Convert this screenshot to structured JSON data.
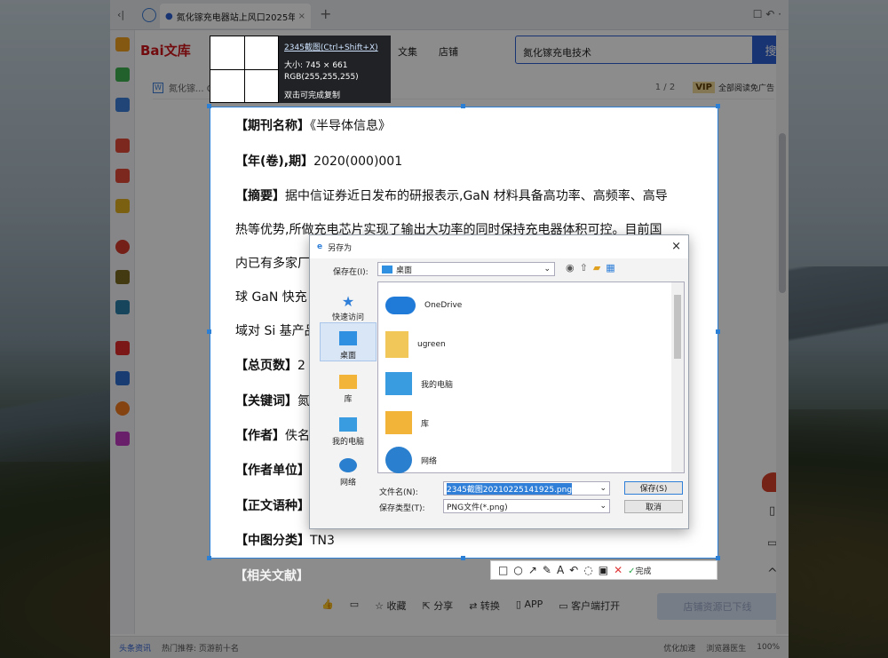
{
  "browser": {
    "tab_title": "氮化镓充电器站上风口2025年",
    "new_tab": "+",
    "site_logo": "Bai文库",
    "nav_items": [
      "文集",
      "店铺"
    ],
    "search_value": "氮化镓充电技术",
    "search_button": "搜",
    "doc_title": "氮化镓... GaN快充市场规模有望达...",
    "page_indicator": "1 / 2",
    "vip_badge": "VIP",
    "vip_text": "全部阅读免广告"
  },
  "magnifier": {
    "hotkey": "2345截图(Ctrl+Shift+X)",
    "size": "大小:  745 × 661",
    "rgb": "RGB(255,255,255)",
    "hint": "双击可完成复制"
  },
  "document": {
    "journal_label": "【期刊名称】",
    "journal": "《半导体信息》",
    "year_label": "【年(卷),期】",
    "year": "2020(000)001",
    "abstract_label": "【摘要】",
    "abstract_1": "据中信证券近日发布的研报表示,GaN 材料具备高功率、高频率、高导",
    "abstract_2": "热等优势,所做充电芯片实现了输出大功率的同时保持充电器体积可控。目前国",
    "abstract_3": "内已有多家厂",
    "abstract_4": "球 GaN 快充",
    "abstract_5": "域对 Si 基产品",
    "pages_label": "【总页数】",
    "pages": "2",
    "keywords_label": "【关键词】",
    "keywords": "氮",
    "author_label": "【作者】",
    "author": "佚名",
    "unit_label": "【作者单位】",
    "lang_label": "【正文语种】",
    "class_label": "【中图分类】",
    "class": "TN3",
    "related_label": "【相关文献】"
  },
  "dialog": {
    "title": "另存为",
    "save_in_label": "保存在(I):",
    "save_in_value": "桌面",
    "nav": [
      "快速访问",
      "桌面",
      "库",
      "我的电脑",
      "网络"
    ],
    "files": [
      "OneDrive",
      "ugreen",
      "我的电脑",
      "库",
      "网络"
    ],
    "filename_label": "文件名(N):",
    "filename_value": "2345截图20210225141925.png",
    "filetype_label": "保存类型(T):",
    "filetype_value": "PNG文件(*.png)",
    "save_button": "保存(S)",
    "cancel_button": "取消"
  },
  "capture_toolbar": {
    "done": "完成"
  },
  "bottom_actions": [
    "收藏",
    "分享",
    "转换",
    "APP",
    "客户端打开"
  ],
  "bottom_cta": "店铺资源已下线",
  "statusbar": {
    "news": "头条资讯",
    "hot": "热门推荐: 页游前十名",
    "optimize": "优化加速",
    "doctor": "浏览器医生",
    "zoom": "100%"
  }
}
